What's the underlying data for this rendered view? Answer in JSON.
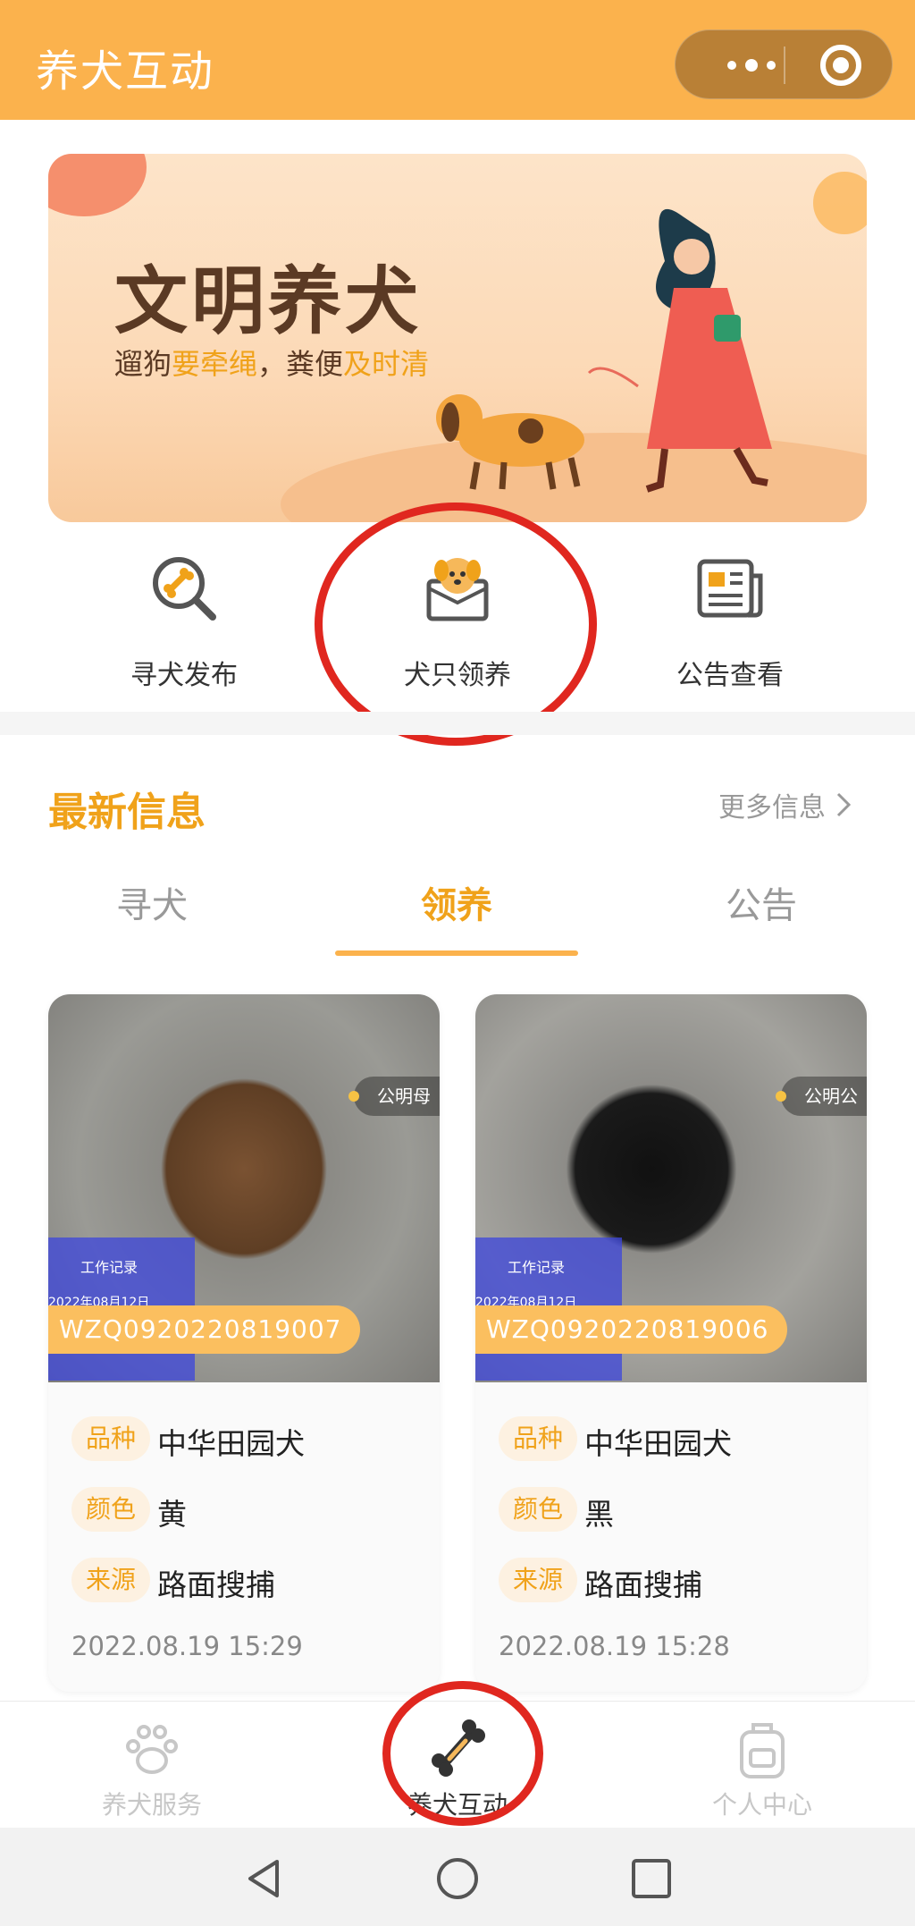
{
  "header": {
    "title": "养犬互动"
  },
  "banner": {
    "title": "文明养犬",
    "sub_prefix": "遛狗",
    "sub_highlight1": "要牵绳",
    "sub_mid": "，粪便",
    "sub_highlight2": "及时清"
  },
  "menu": {
    "items": [
      {
        "label": "寻犬发布",
        "icon": "magnifier-bone-icon"
      },
      {
        "label": "犬只领养",
        "icon": "dog-box-icon"
      },
      {
        "label": "公告查看",
        "icon": "newspaper-icon"
      }
    ]
  },
  "section": {
    "title": "最新信息",
    "more_label": "更多信息"
  },
  "tabs": [
    {
      "label": "寻犬",
      "active": false
    },
    {
      "label": "领养",
      "active": true
    },
    {
      "label": "公告",
      "active": false
    }
  ],
  "cards": [
    {
      "code": "WZQ0920220819007",
      "watermark_chip": "公明母",
      "watermark_box_title": "工作记录",
      "watermark_box_date": "2022年08月12日",
      "tags": {
        "breed_tag": "品种",
        "color_tag": "颜色",
        "source_tag": "来源"
      },
      "breed": "中华田园犬",
      "color": "黄",
      "source": "路面搜捕",
      "date": "2022.08.19 15:29"
    },
    {
      "code": "WZQ0920220819006",
      "watermark_chip": "公明公",
      "watermark_box_title": "工作记录",
      "watermark_box_date": "2022年08月12日",
      "tags": {
        "breed_tag": "品种",
        "color_tag": "颜色",
        "source_tag": "来源"
      },
      "breed": "中华田园犬",
      "color": "黑",
      "source": "路面搜捕",
      "date": "2022.08.19 15:28"
    }
  ],
  "tabbar": {
    "items": [
      {
        "label": "养犬服务",
        "icon": "paw-icon",
        "active": false
      },
      {
        "label": "养犬互动",
        "icon": "bone-icon",
        "active": true
      },
      {
        "label": "个人中心",
        "icon": "backpack-icon",
        "active": false
      }
    ]
  },
  "colors": {
    "accent": "#fbb24d",
    "accent_text": "#f0a21a",
    "annotation_ring": "#e0271f"
  }
}
